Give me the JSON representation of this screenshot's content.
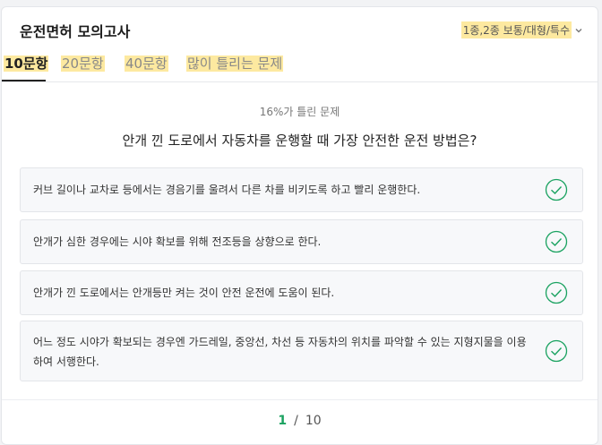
{
  "header": {
    "title": "운전면허 모의고사",
    "license_type": "1종,2종 보통/대형/특수"
  },
  "tabs": [
    {
      "label": "10문항",
      "active": true
    },
    {
      "label": "20문항",
      "active": false
    },
    {
      "label": "40문항",
      "active": false
    },
    {
      "label": "많이 틀리는 문제",
      "active": false
    }
  ],
  "question": {
    "wrong_rate": "16%가 틀린 문제",
    "text": "안개 낀 도로에서 자동차를 운행할 때 가장 안전한 운전 방법은?",
    "options": [
      {
        "text": "커브 길이나 교차로 등에서는 경음기를 울려서 다른 차를 비키도록 하고 빨리 운행한다."
      },
      {
        "text": "안개가 심한 경우에는 시야 확보를 위해 전조등을 상향으로 한다."
      },
      {
        "text": "안개가 낀 도로에서는 안개등만 켜는 것이 안전 운전에 도움이 된다."
      },
      {
        "text": "어느 정도 시야가 확보되는 경우엔 가드레일, 중앙선, 차선 등 자동차의 위치를 파악할 수 있는 지형지물을 이용하여 서행한다."
      }
    ]
  },
  "pager": {
    "current": "1",
    "separator": "/",
    "total": "10"
  },
  "colors": {
    "accent_green": "#1aa260",
    "highlight": "#fde9a0"
  }
}
